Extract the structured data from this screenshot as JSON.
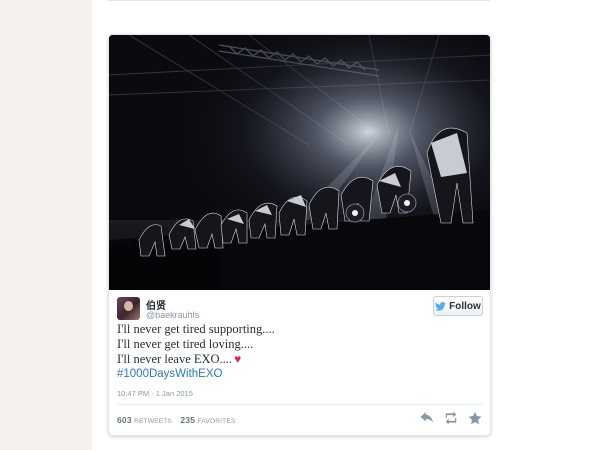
{
  "tweet": {
    "display_name": "伯贤",
    "handle": "@baekrauhls",
    "follow_label": "Follow",
    "text_lines": [
      "I'll never get tired supporting....",
      "I'll never get tired loving....",
      "I'll never leave EXO...."
    ],
    "hashtag": "#1000DaysWithEXO",
    "timestamp": "10:47 PM - 1 Jan 2015",
    "retweets_count": "603",
    "retweets_label": "RETWEETS",
    "favorites_count": "235",
    "favorites_label": "FAVORITES"
  },
  "icons": {
    "bird": "twitter-bird-icon",
    "heart": "heart-icon",
    "reply": "reply-icon",
    "retweet": "retweet-icon",
    "favorite": "star-icon"
  },
  "colors": {
    "link": "#2b7bb9",
    "heart": "#e0245e",
    "twitter_blue": "#55acee",
    "meta_text": "#8899a6"
  }
}
